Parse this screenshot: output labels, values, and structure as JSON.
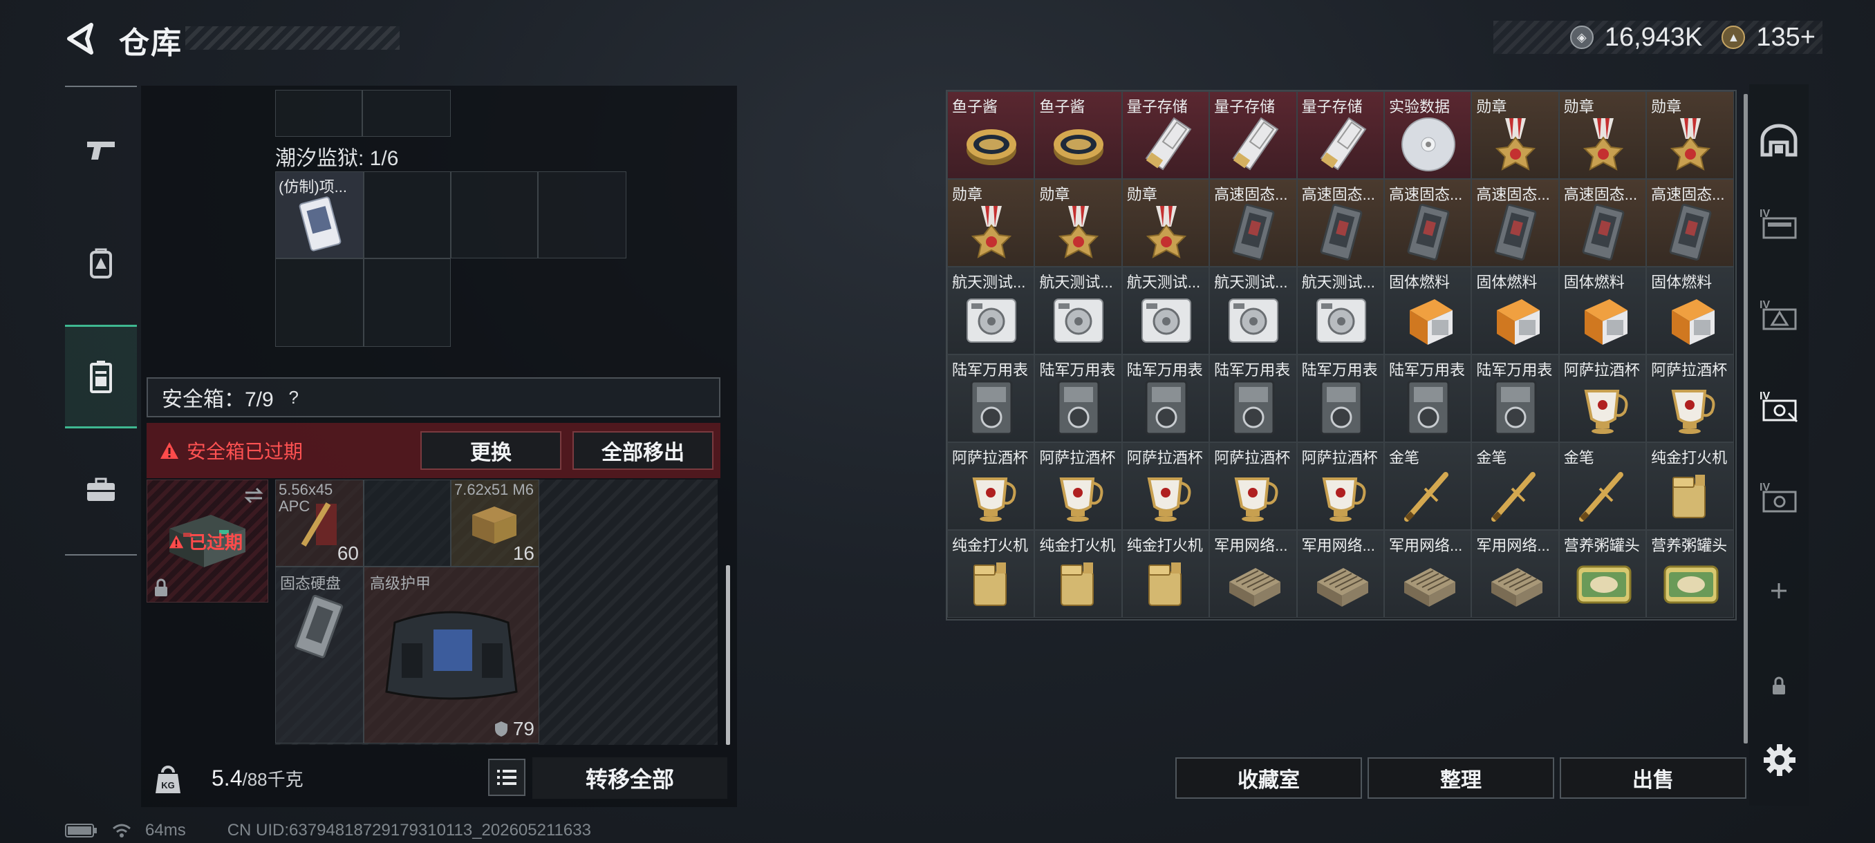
{
  "header": {
    "title": "仓库",
    "currency": [
      {
        "icon": "silver-coin-icon",
        "value": "16,943K"
      },
      {
        "icon": "gold-coin-icon",
        "value": "135+"
      }
    ]
  },
  "left_nav": [
    {
      "icon": "gun-icon"
    },
    {
      "icon": "backpack-icon"
    },
    {
      "icon": "safebox-icon",
      "active": true
    },
    {
      "icon": "briefcase-icon"
    }
  ],
  "left_panel": {
    "tide_prison_label": "潮汐监狱: 1/6",
    "tide_item_label": "(仿制)项...",
    "safebox_label": "安全箱：7/9",
    "safebox_help": "?",
    "expired_warning": "安全箱已过期",
    "replace_button": "更换",
    "move_all_out_button": "全部移出",
    "safebox_icon_text": "已过期",
    "items": [
      {
        "name": "5.56x45 APC",
        "count": "60"
      },
      {
        "name": "7.62x51 M6",
        "count": "16"
      },
      {
        "name": "固态硬盘",
        "count": ""
      },
      {
        "name": "高级护甲",
        "count": "79"
      }
    ],
    "weight_value": "5.4",
    "weight_capacity": "/88千克",
    "transfer_all_button": "转移全部"
  },
  "item_grid": [
    {
      "name": "鱼子酱",
      "art": "caviar",
      "rarity": "red"
    },
    {
      "name": "鱼子酱",
      "art": "caviar",
      "rarity": "red"
    },
    {
      "name": "量子存储",
      "art": "quantum",
      "rarity": "red"
    },
    {
      "name": "量子存储",
      "art": "quantum",
      "rarity": "red"
    },
    {
      "name": "量子存储",
      "art": "quantum",
      "rarity": "red"
    },
    {
      "name": "实验数据",
      "art": "disc",
      "rarity": "red"
    },
    {
      "name": "勋章",
      "art": "medal",
      "rarity": "brown"
    },
    {
      "name": "勋章",
      "art": "medal",
      "rarity": "brown"
    },
    {
      "name": "勋章",
      "art": "medal",
      "rarity": "brown"
    },
    {
      "name": "勋章",
      "art": "medal",
      "rarity": "brown"
    },
    {
      "name": "勋章",
      "art": "medal",
      "rarity": "brown"
    },
    {
      "name": "勋章",
      "art": "medal",
      "rarity": "brown"
    },
    {
      "name": "高速固态...",
      "art": "ssd",
      "rarity": "brown"
    },
    {
      "name": "高速固态...",
      "art": "ssd",
      "rarity": "brown"
    },
    {
      "name": "高速固态...",
      "art": "ssd",
      "rarity": "brown"
    },
    {
      "name": "高速固态...",
      "art": "ssd",
      "rarity": "brown"
    },
    {
      "name": "高速固态...",
      "art": "ssd",
      "rarity": "brown"
    },
    {
      "name": "高速固态...",
      "art": "ssd",
      "rarity": "brown"
    },
    {
      "name": "航天测试...",
      "art": "tester",
      "rarity": "gray"
    },
    {
      "name": "航天测试...",
      "art": "tester",
      "rarity": "gray"
    },
    {
      "name": "航天测试...",
      "art": "tester",
      "rarity": "gray"
    },
    {
      "name": "航天测试...",
      "art": "tester",
      "rarity": "gray"
    },
    {
      "name": "航天测试...",
      "art": "tester",
      "rarity": "gray"
    },
    {
      "name": "固体燃料",
      "art": "fuel",
      "rarity": "gray"
    },
    {
      "name": "固体燃料",
      "art": "fuel",
      "rarity": "gray"
    },
    {
      "name": "固体燃料",
      "art": "fuel",
      "rarity": "gray"
    },
    {
      "name": "固体燃料",
      "art": "fuel",
      "rarity": "gray"
    },
    {
      "name": "陆军万用表",
      "art": "multimeter",
      "rarity": "gray"
    },
    {
      "name": "陆军万用表",
      "art": "multimeter",
      "rarity": "gray"
    },
    {
      "name": "陆军万用表",
      "art": "multimeter",
      "rarity": "gray"
    },
    {
      "name": "陆军万用表",
      "art": "multimeter",
      "rarity": "gray"
    },
    {
      "name": "陆军万用表",
      "art": "multimeter",
      "rarity": "gray"
    },
    {
      "name": "陆军万用表",
      "art": "multimeter",
      "rarity": "gray"
    },
    {
      "name": "陆军万用表",
      "art": "multimeter",
      "rarity": "gray"
    },
    {
      "name": "阿萨拉酒杯",
      "art": "cup",
      "rarity": "gray"
    },
    {
      "name": "阿萨拉酒杯",
      "art": "cup",
      "rarity": "gray"
    },
    {
      "name": "阿萨拉酒杯",
      "art": "cup",
      "rarity": "gray"
    },
    {
      "name": "阿萨拉酒杯",
      "art": "cup",
      "rarity": "gray"
    },
    {
      "name": "阿萨拉酒杯",
      "art": "cup",
      "rarity": "gray"
    },
    {
      "name": "阿萨拉酒杯",
      "art": "cup",
      "rarity": "gray"
    },
    {
      "name": "阿萨拉酒杯",
      "art": "cup",
      "rarity": "gray"
    },
    {
      "name": "金笔",
      "art": "pen",
      "rarity": "gray"
    },
    {
      "name": "金笔",
      "art": "pen",
      "rarity": "gray"
    },
    {
      "name": "金笔",
      "art": "pen",
      "rarity": "gray"
    },
    {
      "name": "纯金打火机",
      "art": "lighter",
      "rarity": "gray"
    },
    {
      "name": "纯金打火机",
      "art": "lighter",
      "rarity": "gray"
    },
    {
      "name": "纯金打火机",
      "art": "lighter",
      "rarity": "gray"
    },
    {
      "name": "纯金打火机",
      "art": "lighter",
      "rarity": "gray"
    },
    {
      "name": "军用网络...",
      "art": "router",
      "rarity": "gray"
    },
    {
      "name": "军用网络...",
      "art": "router",
      "rarity": "gray"
    },
    {
      "name": "军用网络...",
      "art": "router",
      "rarity": "gray"
    },
    {
      "name": "军用网络...",
      "art": "router",
      "rarity": "gray"
    },
    {
      "name": "营养粥罐头",
      "art": "can",
      "rarity": "gray"
    },
    {
      "name": "营养粥罐头",
      "art": "can",
      "rarity": "gray"
    }
  ],
  "bottom_actions": {
    "collection_button": "收藏室",
    "sort_button": "整理",
    "sell_button": "出售"
  },
  "right_nav": [
    {
      "icon": "vault-icon"
    },
    {
      "icon": "storage-iv-1-icon"
    },
    {
      "icon": "storage-iv-2-icon"
    },
    {
      "icon": "storage-iv-3-icon",
      "active": true
    },
    {
      "icon": "storage-iv-4-icon"
    },
    {
      "icon": "add-icon"
    },
    {
      "icon": "lock-icon"
    },
    {
      "icon": "settings-gear-icon"
    }
  ],
  "status_bar": {
    "ping": "64ms",
    "uid": "CN UID:6379481872917931011​3_202605211633"
  }
}
